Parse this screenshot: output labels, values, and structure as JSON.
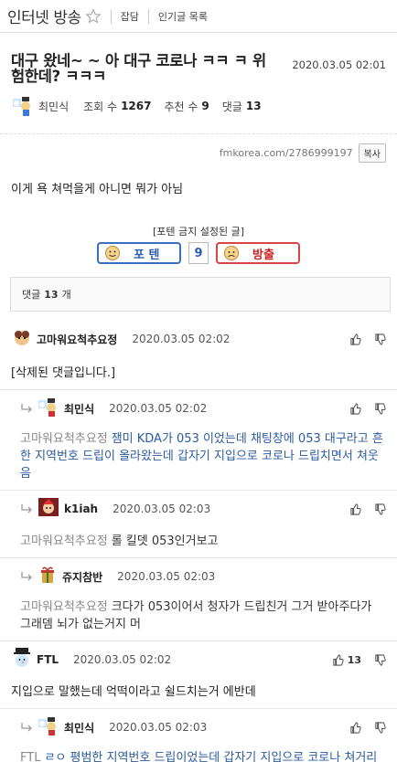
{
  "topbar": {
    "board_title": "인터넷 방송",
    "link_chat": "잡담",
    "link_popular": "인기글 목록"
  },
  "post": {
    "title": "대구 왔네~ ~ 아 대구 코로나 ㅋㅋ ㅋ 위험한데? ㅋㅋㅋ",
    "date": "2020.03.05 02:01",
    "author": "최민식",
    "views_label": "조회 수",
    "views": "1267",
    "recommend_label": "추천 수",
    "recommend": "9",
    "comments_label": "댓글",
    "comments": "13",
    "url": "fmkorea.com/2786999197",
    "copy_label": "복사",
    "body": "이게 욕 쳐먹을게 아니면 뭐가 아님"
  },
  "vote": {
    "caption": "[포텐 금지 설정된 글]",
    "up_label": "포 텐",
    "count": "9",
    "down_label": "방출"
  },
  "comment_box": {
    "prefix": "댓글",
    "count": "13",
    "suffix": "개"
  },
  "comments": [
    {
      "nick": "고마워요척추요정",
      "date": "2020.03.05 02:02",
      "text": "[삭제된 댓글입니다.]"
    },
    {
      "nick": "최민식",
      "date": "2020.03.05 02:02",
      "target": "고마워요척추요정",
      "text": "잼미 KDA가 053 이었는데 채팅창에 053 대구라고 흔한 지역번호 드립이 올라왔는데 갑자기 지입으로 코로나 드립치면서 쳐웃음"
    },
    {
      "nick": "k1iah",
      "date": "2020.03.05 02:03",
      "target": "고마워요척추요정",
      "text": "롤 킬뎃 053인거보고"
    },
    {
      "nick": "쥬지참반",
      "date": "2020.03.05 02:03",
      "target": "고마워요척추요정",
      "text": "크다가 053이어서 청자가 드립친거 그거 받아주다가 그래뎀 뇌가 없는거지 머"
    },
    {
      "nick": "FTL",
      "date": "2020.03.05 02:02",
      "upvotes": "13",
      "text": "지입으로 말했는데 억떡이라고 쉴드치는거 에반데"
    },
    {
      "nick": "최민식",
      "date": "2020.03.05 02:03",
      "target": "FTL",
      "text": "ㄹㅇ 평범한 지역번호 드립이었는데 갑자기 지입으로 코로나 쳐거리는게 ㅅㅂ ㅋㅋㅋㅋ"
    }
  ]
}
